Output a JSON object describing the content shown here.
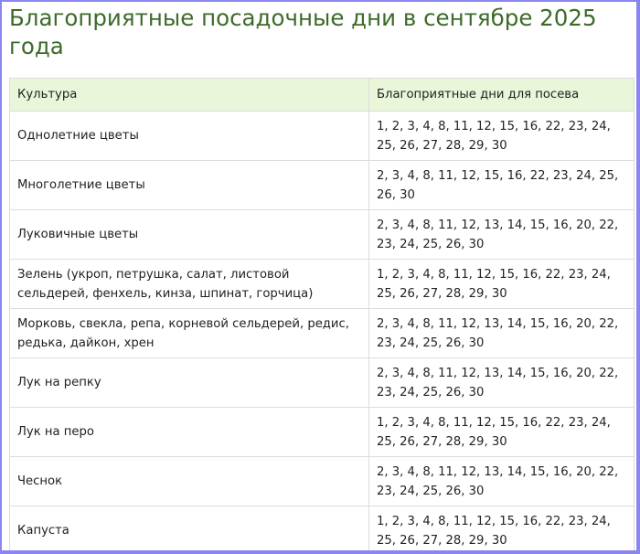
{
  "title": "Благоприятные посадочные дни в сентябре 2025 года",
  "table": {
    "headers": [
      "Культура",
      "Благоприятные дни для посева"
    ],
    "rows": [
      [
        "Однолетние цветы",
        "1, 2, 3, 4, 8, 11, 12, 15, 16, 22, 23, 24, 25, 26, 27, 28, 29, 30"
      ],
      [
        "Многолетние цветы",
        "2, 3, 4, 8, 11, 12, 15, 16, 22, 23, 24, 25, 26, 30"
      ],
      [
        "Луковичные цветы",
        "2, 3, 4, 8, 11, 12, 13, 14, 15, 16, 20, 22, 23, 24, 25, 26, 30"
      ],
      [
        "Зелень (укроп, петрушка, салат, листовой сельдерей, фенхель, кинза, шпинат, горчица)",
        "1, 2, 3, 4, 8, 11, 12, 15, 16, 22, 23, 24, 25, 26, 27, 28, 29, 30"
      ],
      [
        "Морковь, свекла, репа, корневой сельдерей, редис, редька, дайкон, хрен",
        "2, 3, 4, 8, 11, 12, 13, 14, 15, 16, 20, 22, 23, 24, 25, 26, 30"
      ],
      [
        "Лук на репку",
        "2, 3, 4, 8, 11, 12, 13, 14, 15, 16, 20, 22, 23, 24, 25, 26, 30"
      ],
      [
        "Лук на перо",
        "1, 2, 3, 4, 8, 11, 12, 15, 16, 22, 23, 24, 25, 26, 27, 28, 29, 30"
      ],
      [
        "Чеснок",
        "2, 3, 4, 8, 11, 12, 13, 14, 15, 16, 20, 22, 23, 24, 25, 26, 30"
      ],
      [
        "Капуста",
        "1, 2, 3, 4, 8, 11, 12, 15, 16, 22, 23, 24, 25, 26, 27, 28, 29, 30"
      ]
    ]
  },
  "colors": {
    "title": "#3d6b2a",
    "header_background": "#eaf6d9",
    "frame_border": "#8a86f0",
    "cell_border": "#dcdcdc"
  }
}
